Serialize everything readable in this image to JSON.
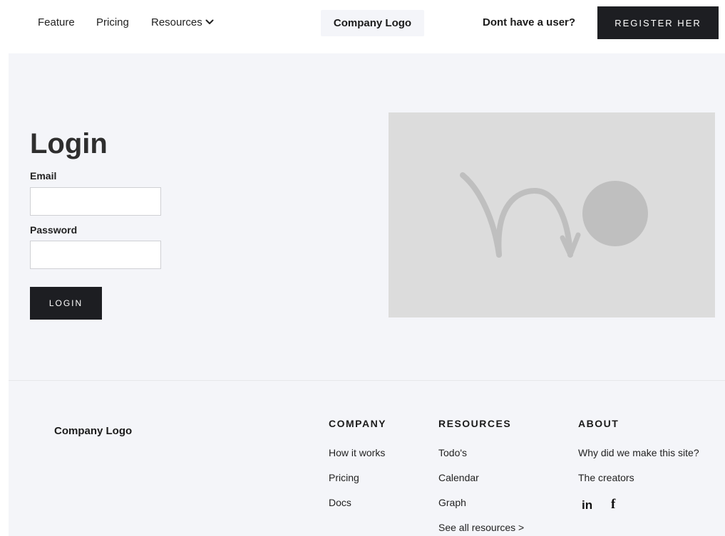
{
  "header": {
    "nav": [
      {
        "label": "Feature"
      },
      {
        "label": "Pricing"
      },
      {
        "label": "Resources"
      }
    ],
    "logo": "Company Logo",
    "no_account_text": "Dont have a user?",
    "register_label": "REGISTER HER"
  },
  "login": {
    "title": "Login",
    "email_label": "Email",
    "email_value": "",
    "password_label": "Password",
    "password_value": "",
    "button_label": "LOGIN"
  },
  "footer": {
    "logo": "Company Logo",
    "columns": [
      {
        "heading": "COMPANY",
        "links": [
          "How it works",
          "Pricing",
          "Docs"
        ]
      },
      {
        "heading": "RESOURCES",
        "links": [
          "Todo's",
          "Calendar",
          "Graph",
          "See all resources >"
        ]
      },
      {
        "heading": "ABOUT",
        "links": [
          "Why did we make this site?",
          "The creators"
        ]
      }
    ],
    "social": {
      "linkedin": "in",
      "facebook": "f"
    }
  },
  "colors": {
    "dark": "#1d1e22",
    "panel": "#f4f5f9",
    "placeholder_image": "#dcdcdc",
    "placeholder_mark": "#bfbfbf"
  },
  "icons": [
    "chevron-down-icon",
    "image-placeholder-icon",
    "linkedin-icon",
    "facebook-icon"
  ]
}
